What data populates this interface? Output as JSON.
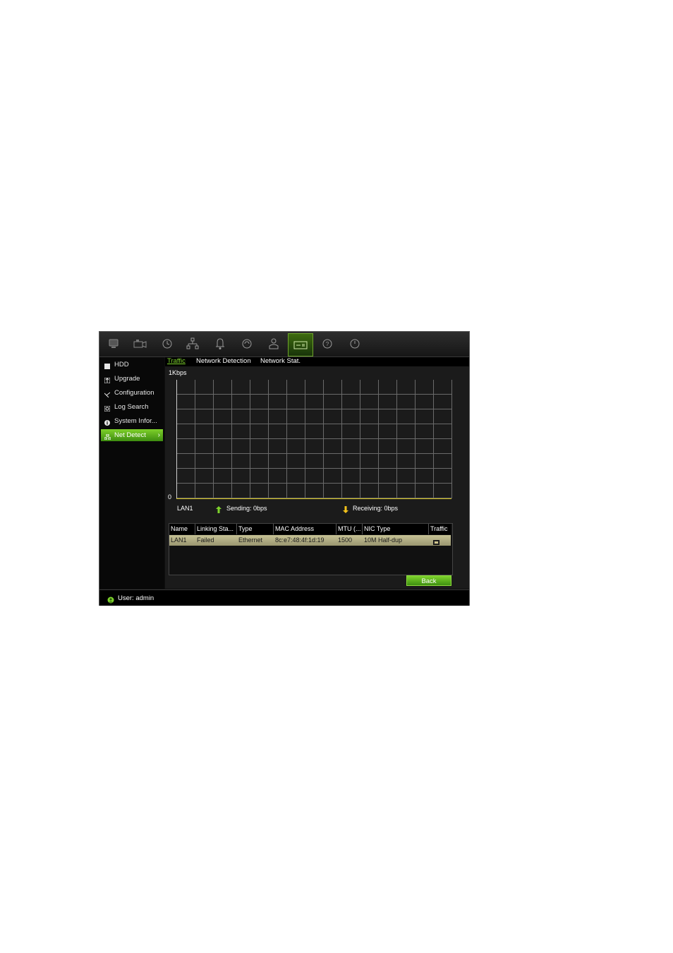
{
  "topbar": {
    "icons": [
      "monitor-icon",
      "camera-icon",
      "clock-icon",
      "network-icon",
      "alarm-bell-icon",
      "shield-icon",
      "user-icon",
      "system-maintenance-icon",
      "help-icon",
      "power-icon"
    ],
    "active_index": 7
  },
  "sidebar": {
    "items": [
      {
        "label": "HDD",
        "icon": "hdd-icon"
      },
      {
        "label": "Upgrade",
        "icon": "upgrade-icon"
      },
      {
        "label": "Configuration",
        "icon": "configuration-icon"
      },
      {
        "label": "Log Search",
        "icon": "log-search-icon"
      },
      {
        "label": "System Infor...",
        "icon": "info-icon"
      },
      {
        "label": "Net Detect",
        "icon": "net-detect-icon",
        "active": true
      }
    ]
  },
  "tabs": [
    {
      "label": "Traffic",
      "active": true
    },
    {
      "label": "Network Detection"
    },
    {
      "label": "Network Stat."
    }
  ],
  "graph": {
    "y_max_label": "1Kbps",
    "y_min_label": "0",
    "interface": "LAN1",
    "sending": "Sending: 0bps",
    "receiving": "Receiving: 0bps"
  },
  "table": {
    "headers": [
      "Name",
      "Linking Sta...",
      "Type",
      "MAC Address",
      "MTU (...",
      "NIC Type",
      "Traffic"
    ],
    "rows": [
      {
        "name": "LAN1",
        "status": "Failed",
        "type": "Ethernet",
        "mac": "8c:e7:48:4f:1d:19",
        "mtu": "1500",
        "nic": "10M Half-dup"
      }
    ]
  },
  "buttons": {
    "back": "Back"
  },
  "status": {
    "user": "User: admin"
  },
  "colors": {
    "accent": "#7ed32c",
    "receive_arrow": "#f2c21b",
    "send_arrow": "#7ed32c"
  }
}
